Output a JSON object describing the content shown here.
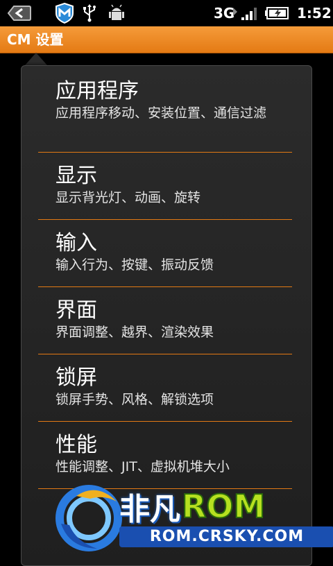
{
  "status_bar": {
    "back_icon": "back-arrow-icon",
    "app_icon": "security-m-icon",
    "usb_icon": "usb-icon",
    "android_icon": "android-debug-icon",
    "network": "3G",
    "time": "1:52"
  },
  "title_bar": {
    "title": "CM 设置"
  },
  "menu": {
    "items": [
      {
        "title": "应用程序",
        "subtitle": "应用程序移动、安装位置、通信过滤"
      },
      {
        "title": "显示",
        "subtitle": "显示背光灯、动画、旋转"
      },
      {
        "title": "输入",
        "subtitle": "输入行为、按键、振动反馈"
      },
      {
        "title": "界面",
        "subtitle": "界面调整、越界、渲染效果"
      },
      {
        "title": "锁屏",
        "subtitle": "锁屏手势、风格、解锁选项"
      },
      {
        "title": "性能",
        "subtitle": "性能调整、JIT、虚拟机堆大小"
      }
    ]
  },
  "watermark": {
    "name_cn": "非凡",
    "name_rom": "ROM",
    "url": "ROM.CRSKY.COM"
  },
  "colors": {
    "accent": "#e47a14",
    "background": "#000000",
    "panel": "#2b2b2b"
  }
}
